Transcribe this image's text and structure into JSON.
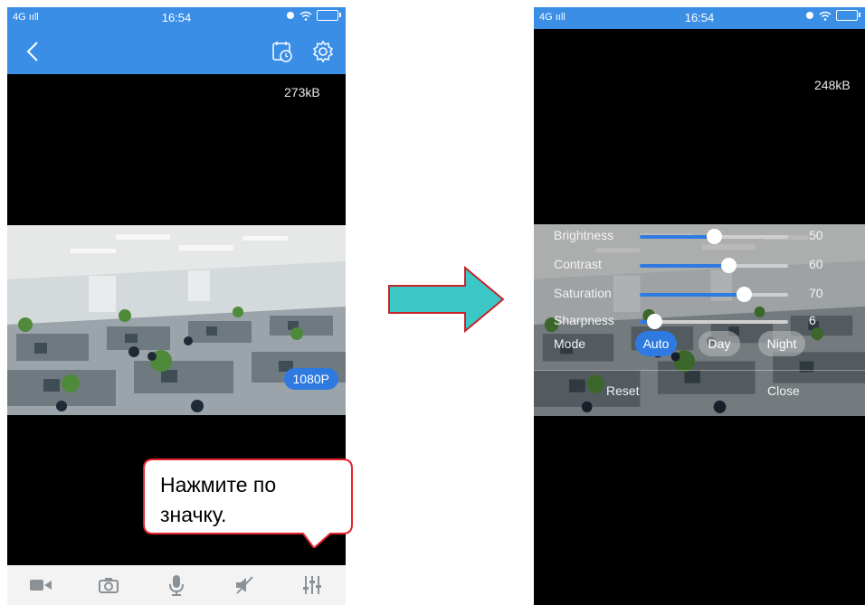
{
  "left_screen": {
    "status_bar": {
      "signal": "4G ııll",
      "time": "16:54"
    },
    "bitrate": "273kB",
    "resolution_badge": "1080P",
    "toolbar": [
      "video-camera-icon",
      "camera-icon",
      "microphone-icon",
      "speaker-muted-icon",
      "equalizer-icon"
    ]
  },
  "tooltip": {
    "line1": "Нажмите по",
    "line2": "значку."
  },
  "right_screen": {
    "status_bar": {
      "signal": "4G ııll",
      "time": "16:54"
    },
    "bitrate": "248kB",
    "adjustments": [
      {
        "label": "Brightness",
        "value": "50",
        "level": 0.5
      },
      {
        "label": "Contrast",
        "value": "60",
        "level": 0.6
      },
      {
        "label": "Saturation",
        "value": "70",
        "level": 0.7
      },
      {
        "label": "Sharpness",
        "value": "6",
        "level": 0.1
      }
    ],
    "mode": {
      "label": "Mode",
      "options": [
        "Auto",
        "Day",
        "Night"
      ],
      "selected": "Auto"
    },
    "reset_label": "Reset",
    "close_label": "Close"
  },
  "colors": {
    "accent": "#3a8ee6",
    "badge": "#2f7ae0",
    "tooltip_border": "#e8222b",
    "arrow_fill": "#3cc7c7"
  }
}
